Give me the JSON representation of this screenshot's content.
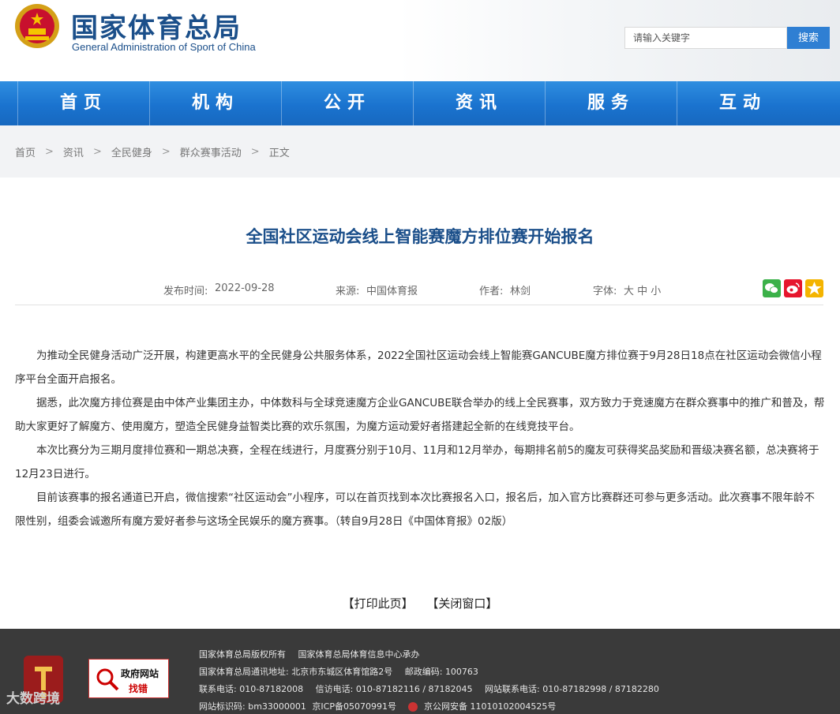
{
  "header": {
    "title": "国家体育总局",
    "subtitle": "General Administration of Sport of China",
    "search_placeholder": "请输入关键字",
    "search_button": "搜索"
  },
  "nav": [
    "首页",
    "机构",
    "公开",
    "资讯",
    "服务",
    "互动"
  ],
  "breadcrumb": [
    "首页",
    "资讯",
    "全民健身",
    "群众赛事活动",
    "正文"
  ],
  "breadcrumb_separator": ">",
  "article": {
    "title": "全国社区运动会线上智能赛魔方排位赛开始报名",
    "publish_label": "发布时间:",
    "publish_date": "2022-09-28",
    "source_label": "来源:",
    "source": "中国体育报",
    "author_label": "作者:",
    "author": "林剑",
    "font_label": "字体:",
    "font_sizes": "大 中 小",
    "paragraphs": [
      "为推动全民健身活动广泛开展，构建更高水平的全民健身公共服务体系，2022全国社区运动会线上智能赛GANCUBE魔方排位赛于9月28日18点在社区运动会微信小程序平台全面开启报名。",
      "据悉，此次魔方排位赛是由中体产业集团主办，中体数科与全球竞速魔方企业GANCUBE联合举办的线上全民赛事，双方致力于竞速魔方在群众赛事中的推广和普及，帮助大家更好了解魔方、使用魔方，塑造全民健身益智类比赛的欢乐氛围，为魔方运动爱好者搭建起全新的在线竞技平台。",
      "本次比赛分为三期月度排位赛和一期总决赛，全程在线进行，月度赛分别于10月、11月和12月举办，每期排名前5的魔友可获得奖品奖励和晋级决赛名额，总决赛将于12月23日进行。",
      "目前该赛事的报名通道已开启，微信搜索“社区运动会”小程序，可以在首页找到本次比赛报名入口，报名后，加入官方比赛群还可参与更多活动。此次赛事不限年龄不限性别，组委会诚邀所有魔方爱好者参与这场全民娱乐的魔方赛事。（转自9月28日《中国体育报》02版）"
    ]
  },
  "actions": {
    "print": "【打印此页】",
    "close": "【关闭窗口】"
  },
  "footer": {
    "badge_line1": "政府网站",
    "badge_line2": "找错",
    "copyright": "国家体育总局版权所有",
    "host": "国家体育总局体育信息中心承办",
    "address_label": "国家体育总局通讯地址:",
    "address": "北京市东城区体育馆路2号",
    "postcode_label": "邮政编码:",
    "postcode": "100763",
    "phone_label": "联系电话:",
    "phone": "010-87182008",
    "letter_label": "信访电话:",
    "letter": "010-87182116 / 87182045",
    "site_phone_label": "网站联系电话:",
    "site_phone": "010-87182998 / 87182280",
    "site_id_label": "网站标识码:",
    "site_id": "bm33000001",
    "icp": "京ICP备05070991号",
    "police": "京公网安备 11010102004525号"
  },
  "watermark": "大数跨境",
  "colors": {
    "brand_blue": "#1b4f8a",
    "nav_blue": "#1a73cf",
    "footer_bg": "#3a3a3a"
  }
}
